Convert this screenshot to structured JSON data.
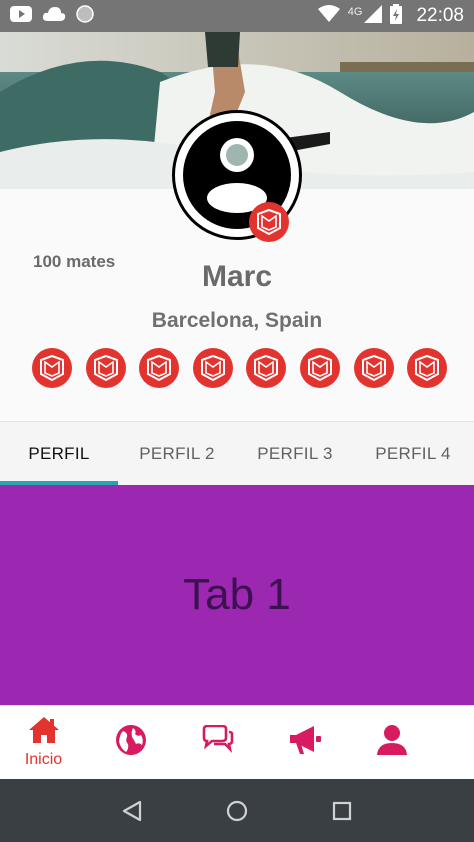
{
  "status_bar": {
    "time": "22:08",
    "network": "4G",
    "icons": [
      "youtube-icon",
      "cloud-icon",
      "circle-icon",
      "wifi-icon",
      "signal-icon",
      "battery-icon"
    ]
  },
  "profile": {
    "mates": "100 mates",
    "name": "Marc",
    "location": "Barcelona, Spain",
    "badge_count": 8
  },
  "tabs": [
    {
      "label": "PERFIL",
      "active": true
    },
    {
      "label": "PERFIL 2",
      "active": false
    },
    {
      "label": "PERFIL 3",
      "active": false
    },
    {
      "label": "PERFIL 4",
      "active": false
    }
  ],
  "content": {
    "text": "Tab 1"
  },
  "bottom_nav": {
    "items": [
      {
        "icon": "home-icon",
        "label": "Inicio",
        "active": true
      },
      {
        "icon": "globe-icon",
        "label": "",
        "active": false
      },
      {
        "icon": "chat-icon",
        "label": "",
        "active": false
      },
      {
        "icon": "megaphone-icon",
        "label": "",
        "active": false
      },
      {
        "icon": "user-icon",
        "label": "",
        "active": false
      }
    ]
  },
  "colors": {
    "accent": "#e2332e",
    "nav_icon": "#d81b60",
    "tab_indicator": "#2aa3b3",
    "content_bg": "#9c27b0",
    "status_bar": "#757575",
    "system_nav": "#3a3f44"
  }
}
